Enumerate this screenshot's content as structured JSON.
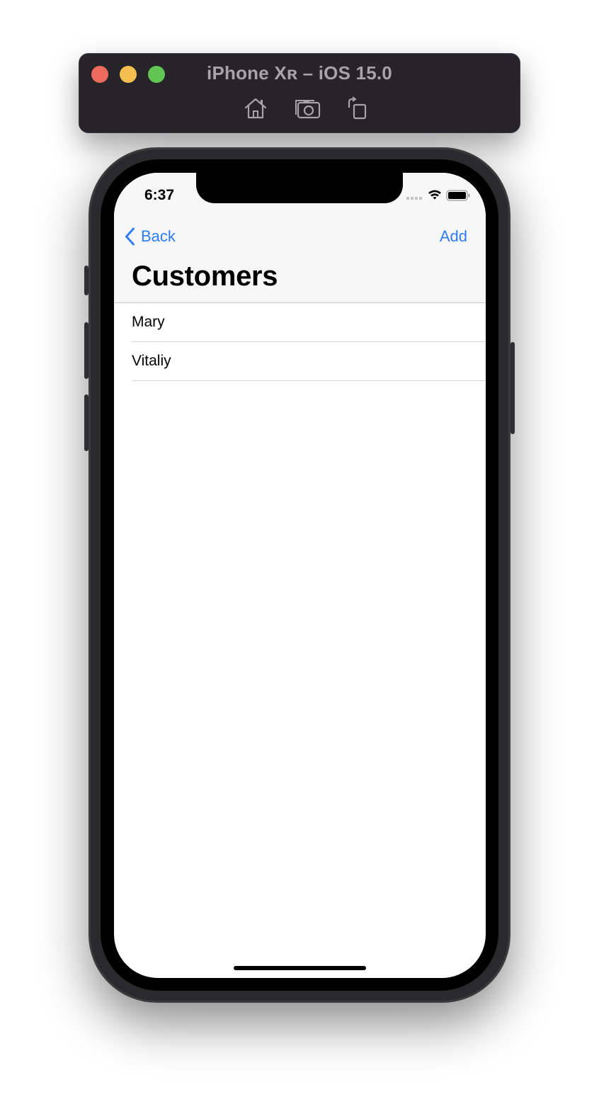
{
  "simulator": {
    "title": "iPhone Xʀ – iOS 15.0",
    "tools": [
      "home-icon",
      "screenshot-icon",
      "rotate-icon"
    ]
  },
  "status_bar": {
    "time": "6:37",
    "icons": [
      "cellular-icon",
      "wifi-icon",
      "battery-icon"
    ]
  },
  "nav": {
    "back_label": "Back",
    "add_label": "Add",
    "title": "Customers"
  },
  "customers": [
    {
      "name": "Mary"
    },
    {
      "name": "Vitaliy"
    }
  ],
  "colors": {
    "accent": "#2f7cf6",
    "nav_background": "#f7f7f7",
    "window_chrome": "#262428"
  }
}
